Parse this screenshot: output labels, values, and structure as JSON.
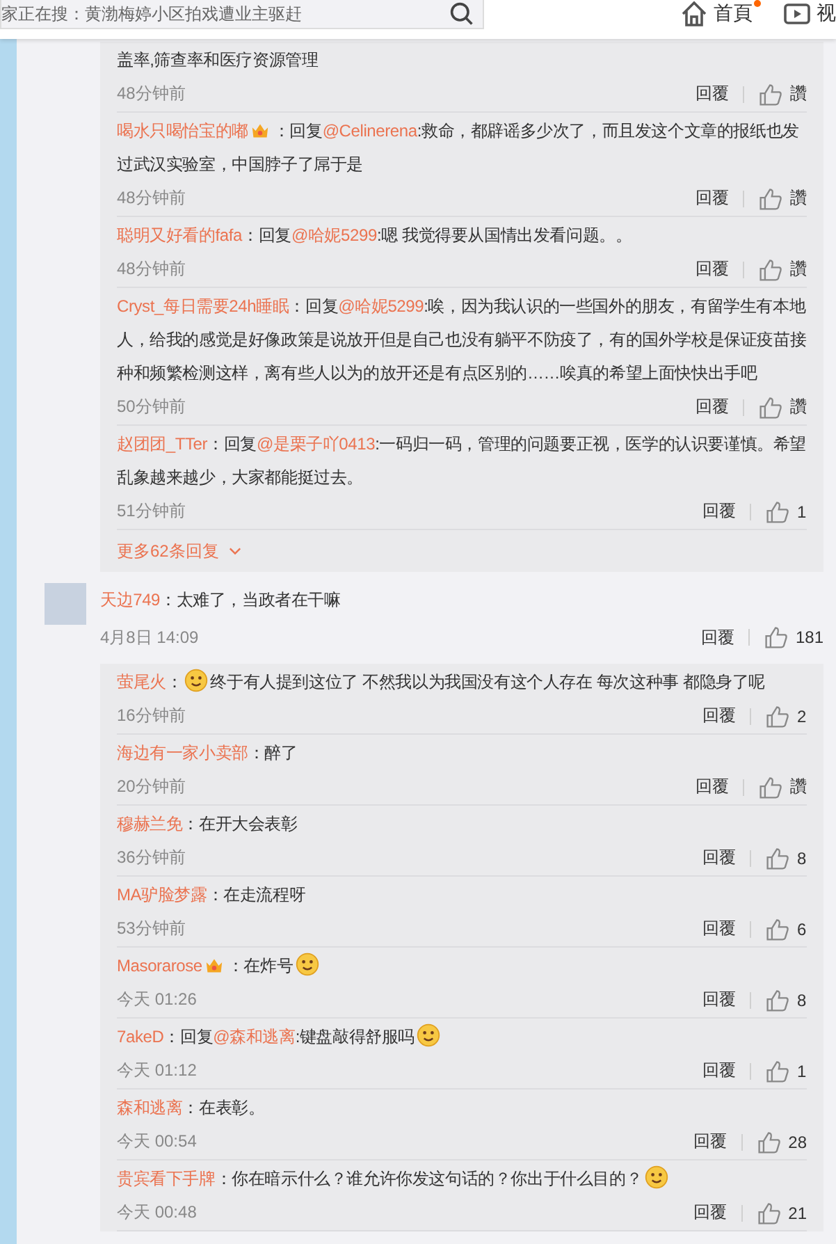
{
  "header": {
    "search": {
      "placeholder": "家正在搜：黄渤梅婷小区拍戏遭业主驱赶"
    },
    "nav": [
      {
        "label": "首頁",
        "kind": "home",
        "dot": true
      },
      {
        "label": "视",
        "kind": "video",
        "dot": false
      }
    ]
  },
  "thread": {
    "replies": [
      {
        "text": "盖率,筛查率和医疗资源管理",
        "time": "48分钟前",
        "reply_label": "回覆",
        "likes": "讚"
      },
      {
        "user": "喝水只喝怡宝的嘟",
        "badge": true,
        "sep": "：",
        "prefix": "回复",
        "mention": "@Celinerena",
        "text": ":救命，都辟谣多少次了，而且发这个文章的报纸也发过武汉实验室，中国脖子了屌于是",
        "time": "48分钟前",
        "reply_label": "回覆",
        "likes": "讚"
      },
      {
        "user": "聪明又好看的fafa",
        "sep": "：",
        "prefix": "回复",
        "mention": "@哈妮5299",
        "text": ":嗯 我觉得要从国情出发看问题。。",
        "time": "48分钟前",
        "reply_label": "回覆",
        "likes": "讚"
      },
      {
        "user": "Cryst_每日需要24h睡眠",
        "sep": "：",
        "prefix": "回复",
        "mention": "@哈妮5299",
        "text": ":唉，因为我认识的一些国外的朋友，有留学生有本地人，给我的感觉是好像政策是说放开但是自己也没有躺平不防疫了，有的国外学校是保证疫苗接种和频繁检测这样，离有些人以为的放开还是有点区别的……唉真的希望上面快快出手吧",
        "time": "50分钟前",
        "reply_label": "回覆",
        "likes": "讚"
      },
      {
        "user": "赵团团_TTer",
        "sep": "：",
        "prefix": "回复",
        "mention": "@是栗子吖0413",
        "text": ":一码归一码，管理的问题要正视，医学的认识要谨慎。希望乱象越来越少，大家都能挺过去。",
        "time": "51分钟前",
        "reply_label": "回覆",
        "likes": "1"
      }
    ],
    "more": "更多62条回复"
  },
  "comment": {
    "user": "天边749",
    "sep": "：",
    "text": "太难了，当政者在干嘛",
    "time": "4月8日 14:09",
    "reply_label": "回覆",
    "likes": "181",
    "replies": [
      {
        "user": "萤尾火",
        "sep": "：",
        "emoji_before": true,
        "text": "终于有人提到这位了 不然我以为我国没有这个人存在 每次这种事 都隐身了呢",
        "time": "16分钟前",
        "reply_label": "回覆",
        "likes": "2"
      },
      {
        "user": "海边有一家小卖部",
        "sep": "：",
        "text": "醉了",
        "time": "20分钟前",
        "reply_label": "回覆",
        "likes": "讚"
      },
      {
        "user": "穆赫兰免",
        "sep": "：",
        "text": "在开大会表彰",
        "time": "36分钟前",
        "reply_label": "回覆",
        "likes": "8"
      },
      {
        "user": "MA驴脸梦露",
        "sep": "：",
        "text": "在走流程呀",
        "time": "53分钟前",
        "reply_label": "回覆",
        "likes": "6"
      },
      {
        "user": "Masorarose",
        "badge": true,
        "sep": "：",
        "text": "在炸号",
        "emoji_after": true,
        "time": "今天 01:26",
        "reply_label": "回覆",
        "likes": "8"
      },
      {
        "user": "7akeD",
        "sep": "：",
        "prefix": "回复",
        "mention": "@森和逃离",
        "text": ":键盘敲得舒服吗",
        "emoji_after": true,
        "time": "今天 01:12",
        "reply_label": "回覆",
        "likes": "1"
      },
      {
        "user": "森和逃离",
        "sep": "：",
        "text": "在表彰。",
        "time": "今天 00:54",
        "reply_label": "回覆",
        "likes": "28"
      },
      {
        "user": "贵宾看下手牌",
        "sep": "：",
        "text": "你在暗示什么？谁允许你发这句话的？你出于什么目的？",
        "emoji_after": true,
        "time": "今天 00:48",
        "reply_label": "回覆",
        "likes": "21"
      }
    ]
  }
}
